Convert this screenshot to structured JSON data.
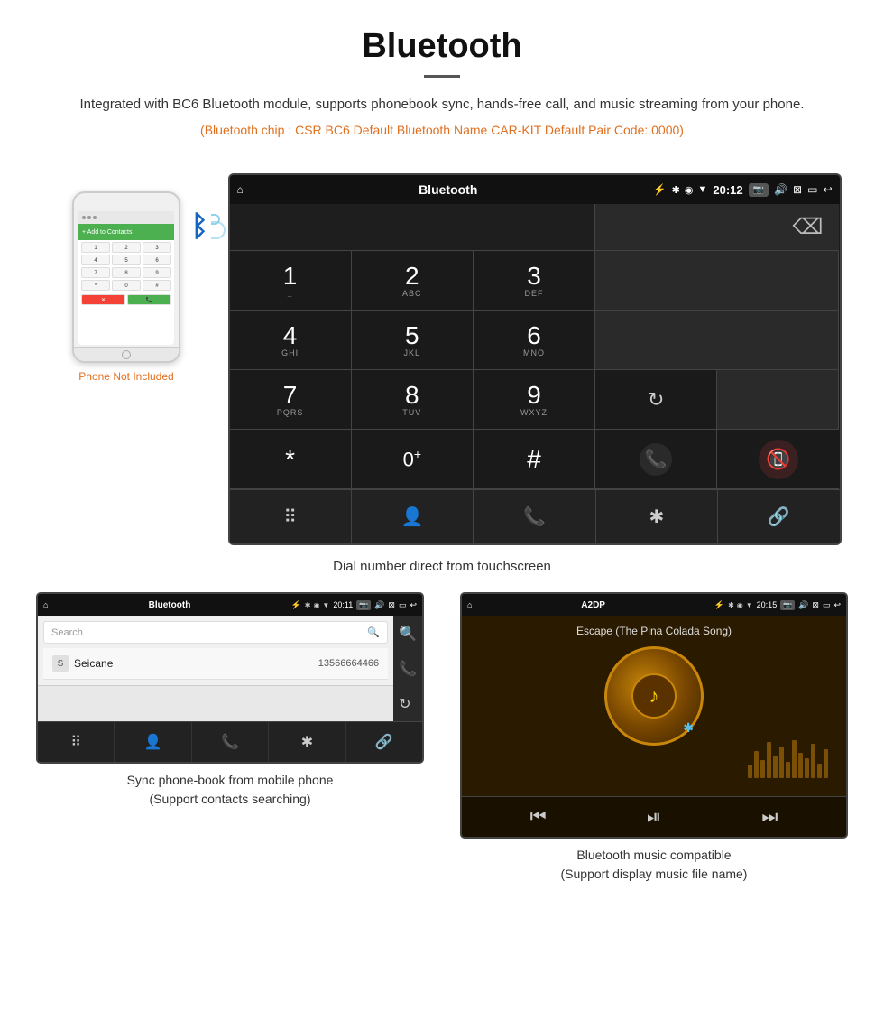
{
  "header": {
    "title": "Bluetooth",
    "description": "Integrated with BC6 Bluetooth module, supports phonebook sync, hands-free call, and music streaming from your phone.",
    "specs": "(Bluetooth chip : CSR BC6    Default Bluetooth Name CAR-KIT    Default Pair Code: 0000)"
  },
  "phone_label": "Phone Not Included",
  "car_screen": {
    "status_bar": {
      "home": "⌂",
      "title": "Bluetooth",
      "usb": "⚡",
      "time": "20:12"
    },
    "dialpad": {
      "keys": [
        {
          "num": "1",
          "sub": ""
        },
        {
          "num": "2",
          "sub": "ABC"
        },
        {
          "num": "3",
          "sub": "DEF"
        },
        {
          "num": "4",
          "sub": "GHI"
        },
        {
          "num": "5",
          "sub": "JKL"
        },
        {
          "num": "6",
          "sub": "MNO"
        },
        {
          "num": "7",
          "sub": "PQRS"
        },
        {
          "num": "8",
          "sub": "TUV"
        },
        {
          "num": "9",
          "sub": "WXYZ"
        },
        {
          "num": "*",
          "sub": ""
        },
        {
          "num": "0",
          "sub": "+"
        },
        {
          "num": "#",
          "sub": ""
        }
      ]
    }
  },
  "main_caption": "Dial number direct from touchscreen",
  "phonebook_panel": {
    "status": {
      "title": "Bluetooth",
      "time": "20:11"
    },
    "search_placeholder": "Search",
    "contact": {
      "letter": "S",
      "name": "Seicane",
      "number": "13566664466"
    },
    "caption_line1": "Sync phone-book from mobile phone",
    "caption_line2": "(Support contacts searching)"
  },
  "music_panel": {
    "status": {
      "title": "A2DP",
      "time": "20:15"
    },
    "song_title": "Escape (The Pina Colada Song)",
    "caption_line1": "Bluetooth music compatible",
    "caption_line2": "(Support display music file name)"
  },
  "equalizer_heights": [
    15,
    30,
    20,
    40,
    25,
    35,
    18,
    42,
    28,
    22,
    38,
    16,
    32
  ]
}
